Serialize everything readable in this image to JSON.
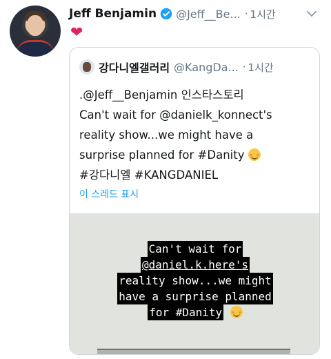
{
  "tweet": {
    "name": "Jeff Benjamin",
    "handle": "@Jeff__Be...",
    "dot": "·",
    "time": "1시간",
    "icons": {
      "verified": "verified-badge-icon",
      "chevron": "chevron-down-icon",
      "like": "heart-icon"
    },
    "colors": {
      "accent": "#1da1f2",
      "heart": "#e0245e",
      "secondary_text": "#657786"
    }
  },
  "quote": {
    "name": "강다니엘갤러리",
    "handle": "@KangDa...",
    "dot": "·",
    "time": "1시간",
    "lines": [
      ".@Jeff__Benjamin 인스타스토리",
      "Can't wait for @danielk_konnect's",
      "reality show...we might have a",
      "surprise planned for #Danity",
      "#강다니엘 #KANGDANIEL"
    ],
    "thread_link": "이 스레드 표시",
    "media": {
      "story_lines": [
        "Can't wait for",
        "@daniel.k.here's",
        "reality show...we might",
        "have a surprise planned",
        "for #Danity"
      ]
    }
  }
}
